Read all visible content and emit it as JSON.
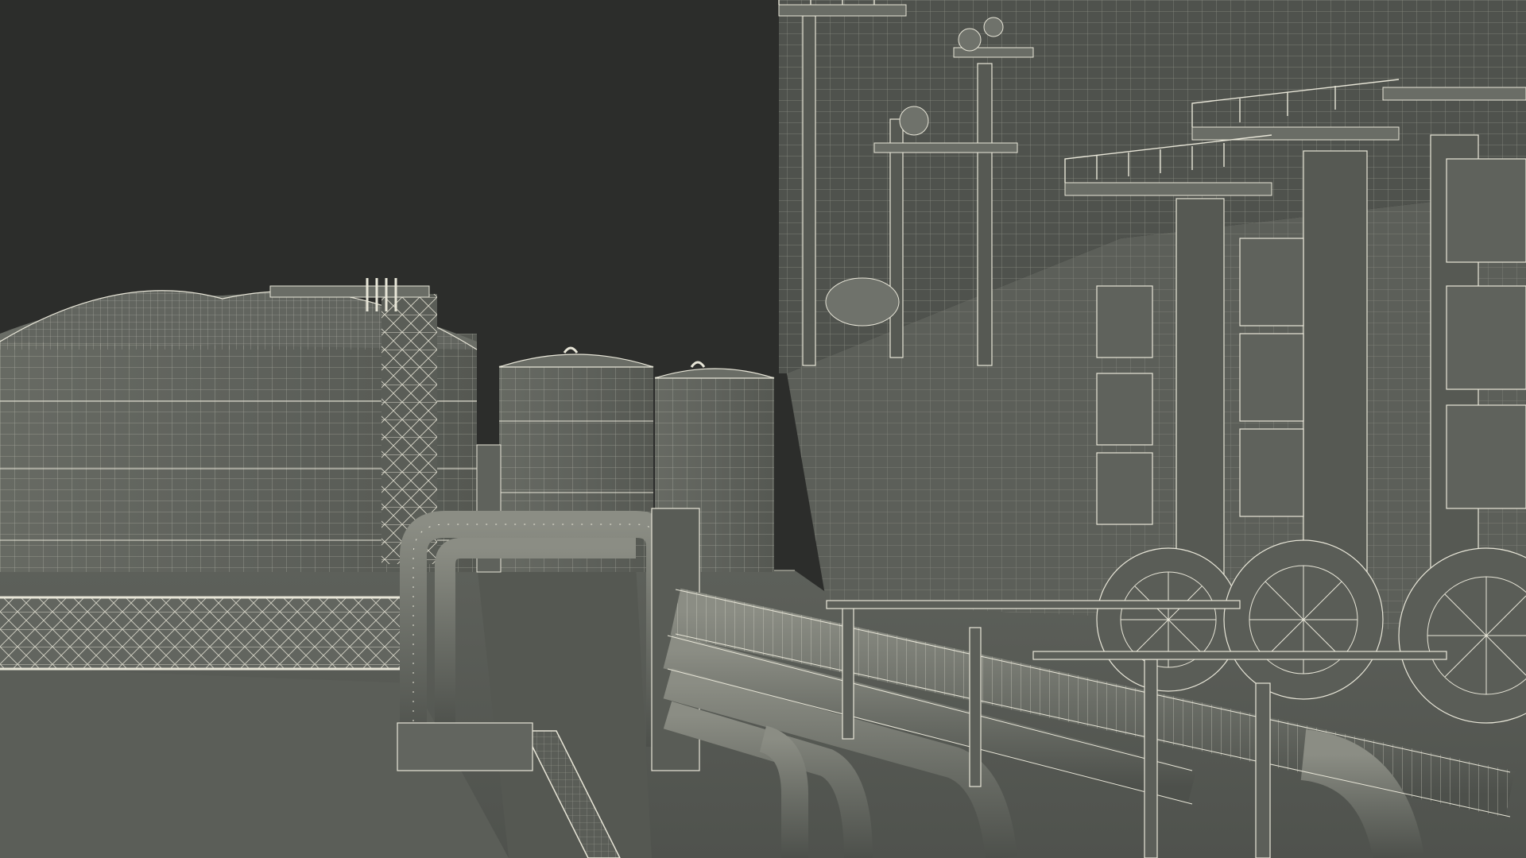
{
  "scene": {
    "colors": {
      "sky": "#2c2d2b",
      "surface": "#5f625c",
      "surface_light": "#72756e",
      "surface_dark": "#4f524d",
      "wire": "#e8e6d8",
      "wire_dim": "#c9c7b8"
    },
    "objects": [
      "lng-storage-tank-large",
      "lng-storage-tank-medium",
      "lng-storage-tank-small",
      "stair-tower",
      "process-plant-structure",
      "gas-turbine-housing",
      "pipe-rack",
      "pipeline-bundle",
      "guard-railing",
      "ground-slab"
    ]
  }
}
